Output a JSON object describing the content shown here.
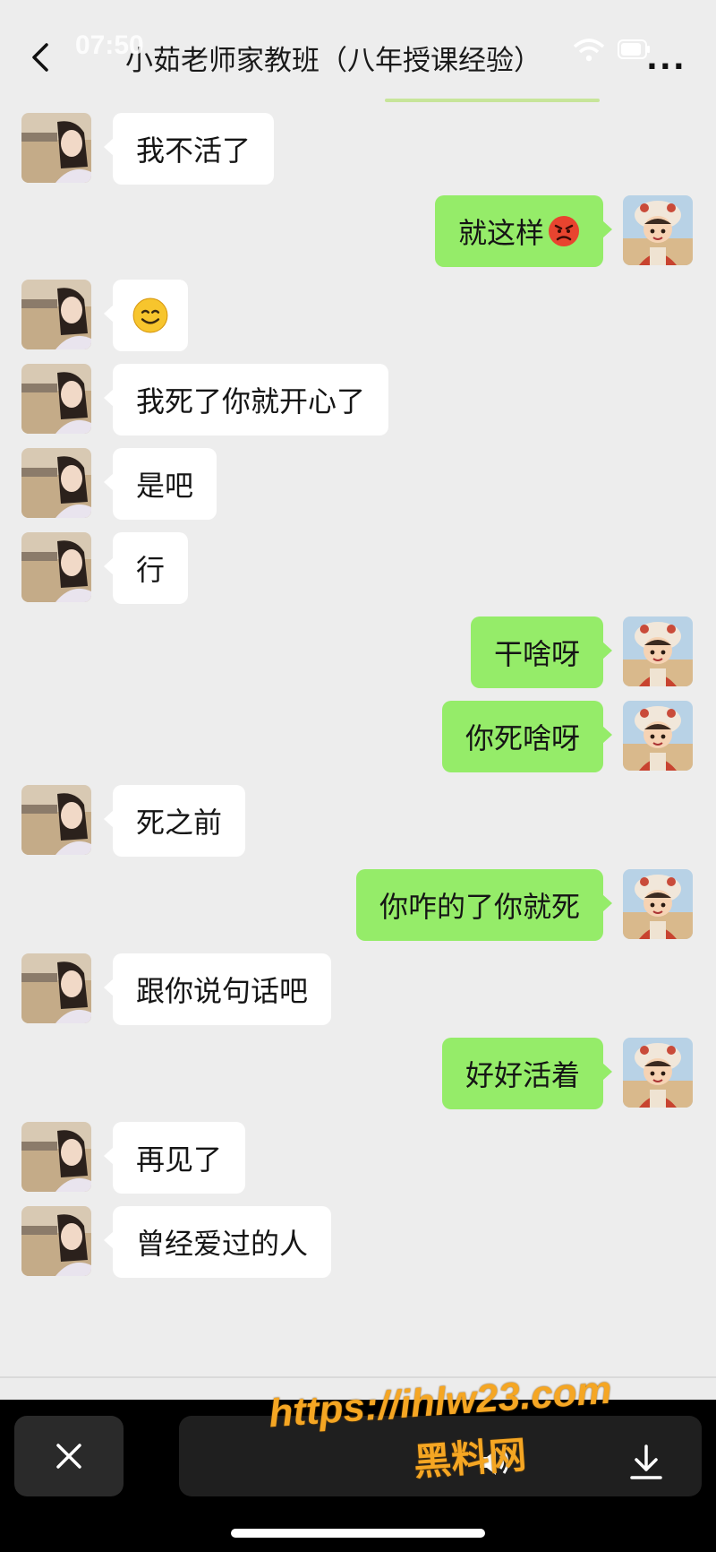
{
  "header": {
    "status_time": "07:50",
    "title": "小茹老师家教班（八年授课经验）",
    "more": "..."
  },
  "messages": [
    {
      "side": "left",
      "text": "我不活了"
    },
    {
      "side": "right",
      "text": "就这样",
      "emoji": "angry-face-emoji"
    },
    {
      "side": "left",
      "text": "",
      "emoji": "smiling-face-emoji"
    },
    {
      "side": "left",
      "text": "我死了你就开心了"
    },
    {
      "side": "left",
      "text": "是吧"
    },
    {
      "side": "left",
      "text": "行"
    },
    {
      "side": "right",
      "text": "干啥呀"
    },
    {
      "side": "right",
      "text": "你死啥呀"
    },
    {
      "side": "left",
      "text": "死之前"
    },
    {
      "side": "right",
      "text": "你咋的了你就死"
    },
    {
      "side": "left",
      "text": "跟你说句话吧"
    },
    {
      "side": "right",
      "text": "好好活着"
    },
    {
      "side": "left",
      "text": "再见了"
    },
    {
      "side": "left",
      "text": "曾经爱过的人"
    }
  ],
  "toolbar": {
    "close_icon": "close-icon",
    "volume_icon": "volume-icon",
    "download_icon": "download-icon"
  },
  "watermark": {
    "url": "https://ihlw23.com",
    "name": "黑料网"
  },
  "colors": {
    "background": "#ededed",
    "incoming_bubble": "#ffffff",
    "outgoing_bubble": "#95ec69",
    "watermark": "#f5a623"
  }
}
